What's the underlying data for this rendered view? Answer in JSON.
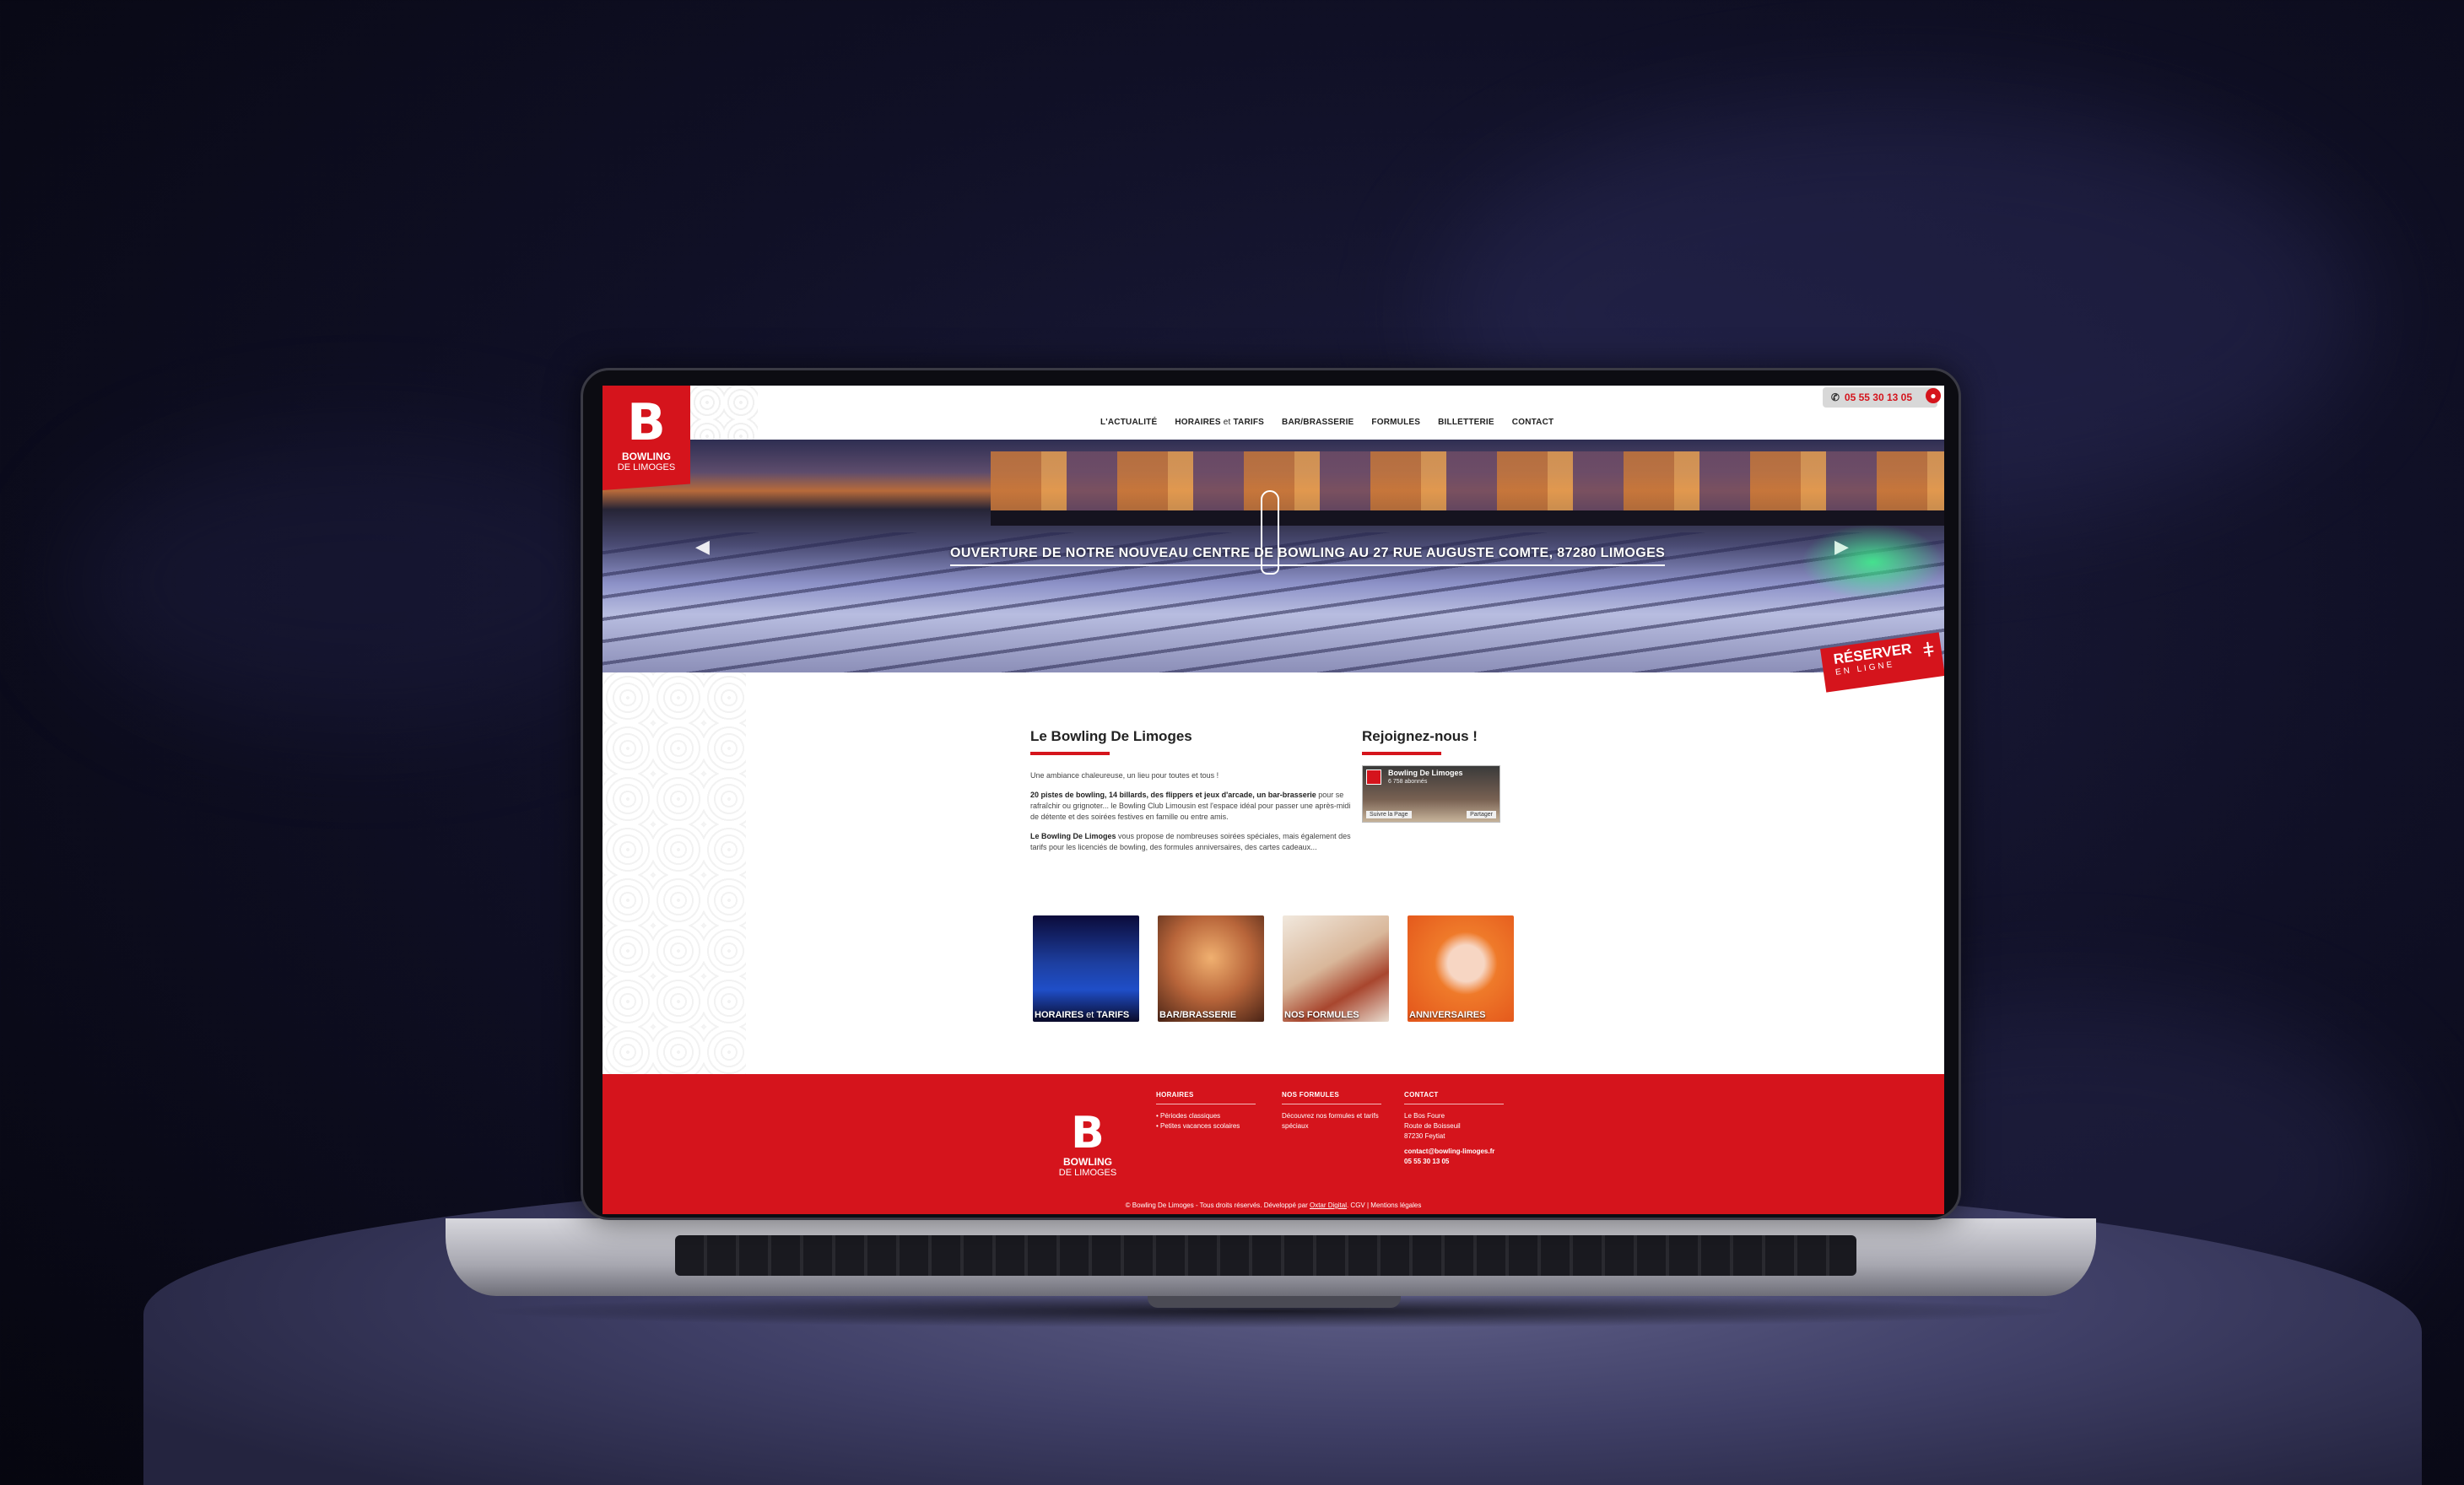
{
  "colors": {
    "brand_red": "#d5141c",
    "white": "#ffffff",
    "dark_text": "#222222"
  },
  "topbar": {
    "phone_icon": "phone-icon",
    "phone": "05 55 30 13 05",
    "user_icon": "user-icon"
  },
  "logo": {
    "letter": "B",
    "line1": "BOWLING",
    "line2": "DE LIMOGES"
  },
  "nav": {
    "items": [
      {
        "label": "L'ACTUALITÉ"
      },
      {
        "label_a": "HORAIRES",
        "label_b": " et ",
        "label_c": "TARIFS"
      },
      {
        "label": "BAR/BRASSERIE"
      },
      {
        "label": "FORMULES"
      },
      {
        "label": "BILLETTERIE"
      },
      {
        "label": "CONTACT"
      }
    ]
  },
  "hero": {
    "title": "OUVERTURE DE NOTRE NOUVEAU CENTRE DE BOWLING AU 27 RUE AUGUSTE COMTE, 87280 LIMOGES",
    "prev_icon": "arrow-left-icon",
    "next_icon": "arrow-right-icon"
  },
  "reserve": {
    "line1": "RÉSERVER",
    "line2": "EN LIGNE"
  },
  "about": {
    "heading": "Le Bowling De Limoges",
    "p1": "Une ambiance chaleureuse, un lieu pour toutes et tous !",
    "p2_bold": "20 pistes de bowling, 14 billards, des flippers et jeux d'arcade, un bar-brasserie",
    "p2_rest": " pour se rafraîchir ou grignoter... le Bowling Club Limousin est l'espace idéal pour passer une après-midi de détente et des soirées festives en famille ou entre amis.",
    "p3_bold": "Le Bowling De Limoges",
    "p3_rest": " vous propose de nombreuses soirées spéciales, mais également des tarifs pour les licenciés de bowling, des formules anniversaires, des cartes cadeaux..."
  },
  "join": {
    "heading": "Rejoignez-nous !",
    "fb_name": "Bowling De Limoges",
    "fb_sub": "6 758 abonnés",
    "fb_follow": "Suivre la Page",
    "fb_share": "Partager"
  },
  "tiles": [
    {
      "caption_a": "HORAIRES",
      "caption_b": " et ",
      "caption_c": "TARIFS"
    },
    {
      "caption": "BAR/BRASSERIE"
    },
    {
      "caption": "NOS FORMULES"
    },
    {
      "caption": "ANNIVERSAIRES"
    }
  ],
  "footer": {
    "horaires": {
      "title": "HORAIRES",
      "items": [
        "Périodes classiques",
        "Petites vacances scolaires"
      ]
    },
    "formules": {
      "title": "NOS FORMULES",
      "text": "Découvrez nos formules et tarifs spéciaux"
    },
    "contact": {
      "title": "CONTACT",
      "l1": "Le Bos Foure",
      "l2": "Route de Boisseuil",
      "l3": "87230 Feytiat",
      "email": "contact@bowling-limoges.fr",
      "phone": "05 55 30 13 05"
    },
    "bottom_a": "© Bowling De Limoges - Tous droits réservés. Développé par ",
    "bottom_link": "Oxtar Digital",
    "bottom_b": ". CGV | Mentions légales"
  }
}
